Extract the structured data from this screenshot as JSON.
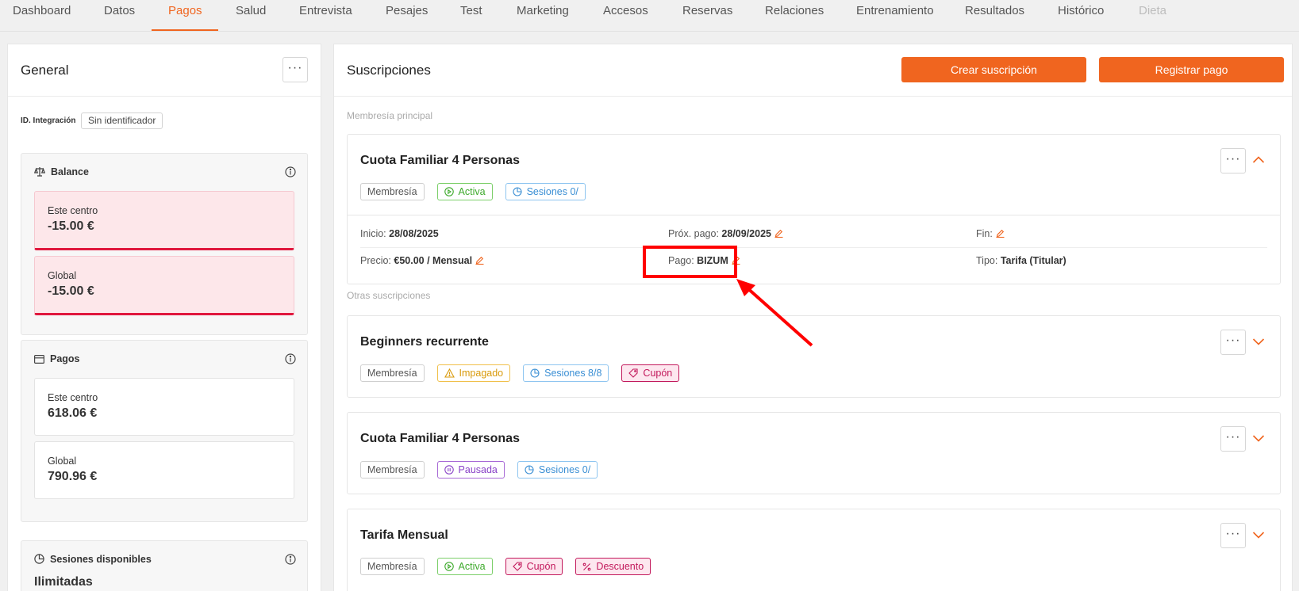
{
  "nav": {
    "tabs": [
      "Dashboard",
      "Datos",
      "Pagos",
      "Salud",
      "Entrevista",
      "Pesajes",
      "Test",
      "Marketing",
      "Accesos",
      "Reservas",
      "Relaciones",
      "Entrenamiento",
      "Resultados",
      "Histórico",
      "Dieta"
    ],
    "active": "Pagos",
    "disabled": "Dieta"
  },
  "general": {
    "title": "General",
    "integration_label": "ID. Integración",
    "integration_value": "Sin identificador",
    "balance": {
      "title": "Balance",
      "items": [
        {
          "label": "Este centro",
          "value": "-15.00 €"
        },
        {
          "label": "Global",
          "value": "-15.00 €"
        }
      ]
    },
    "payments": {
      "title": "Pagos",
      "items": [
        {
          "label": "Este centro",
          "value": "618.06 €"
        },
        {
          "label": "Global",
          "value": "790.96 €"
        }
      ]
    },
    "sessions": {
      "title": "Sesiones disponibles",
      "value": "Ilimitadas"
    }
  },
  "subscriptions": {
    "title": "Suscripciones",
    "create_button": "Crear suscripción",
    "register_button": "Registrar pago",
    "main_label": "Membresía principal",
    "others_label": "Otras suscripciones",
    "main": {
      "name": "Cuota Familiar 4 Personas",
      "tags": [
        "Membresía",
        "Activa",
        "Sesiones 0/"
      ],
      "details": {
        "inicio_label": "Inicio:",
        "inicio_value": "28/08/2025",
        "prox_label": "Próx. pago:",
        "prox_value": "28/09/2025",
        "fin_label": "Fin:",
        "precio_label": "Precio:",
        "precio_value": "€50.00 / Mensual",
        "pago_label": "Pago:",
        "pago_value": "BIZUM",
        "tipo_label": "Tipo:",
        "tipo_value": "Tarifa (Titular)"
      }
    },
    "others": [
      {
        "name": "Beginners recurrente",
        "tags": [
          "Membresía",
          "Impagado",
          "Sesiones 8/8",
          "Cupón"
        ]
      },
      {
        "name": "Cuota Familiar 4 Personas",
        "tags": [
          "Membresía",
          "Pausada",
          "Sesiones 0/"
        ]
      },
      {
        "name": "Tarifa Mensual",
        "tags": [
          "Membresía",
          "Activa",
          "Cupón",
          "Descuento"
        ]
      }
    ]
  },
  "colors": {
    "accent": "#f0651f",
    "negative": "#e0173d",
    "annotation": "#ff0000"
  }
}
